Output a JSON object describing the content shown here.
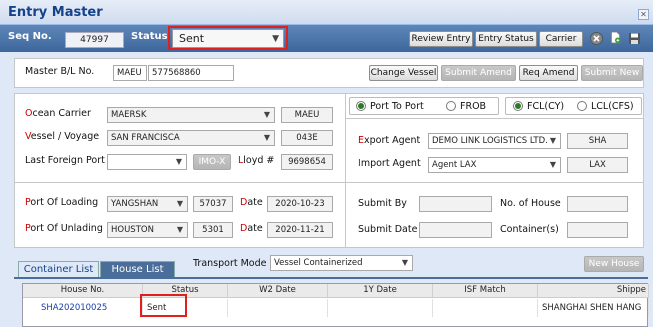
{
  "title": "Entry Master",
  "header": {
    "seq_label": "Seq No.",
    "seq_value": "47997",
    "status_label": "Status",
    "status_value": "Sent",
    "buttons": {
      "review": "Review Entry",
      "entry_status": "Entry Status",
      "carrier": "Carrier"
    }
  },
  "master": {
    "label": "Master B/L No.",
    "prefix": "MAEU",
    "number": "577568860"
  },
  "actions": {
    "change_vessel": "Change Vessel",
    "submit_amend": "Submit Amend",
    "req_amend": "Req Amend",
    "submit_new": "Submit New"
  },
  "carrier": {
    "ocean_label": "cean Carrier",
    "ocean_prefix": "O",
    "ocean_value": "MAERSK",
    "ocean_code": "MAEU",
    "vessel_label": "essel / Voyage",
    "vessel_prefix": "V",
    "vessel_value": "SAN FRANCISCA",
    "voyage": "043E",
    "lfp_label": "Last Foreign Port",
    "imo": "IMO-X",
    "lloyd_label": "loyd #",
    "lloyd_prefix": "L",
    "lloyd_value": "9698654"
  },
  "port_opts": {
    "p2p": "Port To Port",
    "frob": "FROB",
    "fcl": "FCL(CY)",
    "lcl": "LCL(CFS)"
  },
  "agents": {
    "export_label": "xport Agent",
    "export_prefix": "E",
    "export_value": "DEMO LINK LOGISTICS LTD.",
    "export_code": "SHA",
    "import_label": "mport Agent",
    "import_prefix": "I",
    "import_value": "Agent LAX",
    "import_code": "LAX"
  },
  "ports": {
    "pol_label": "ort Of Loading",
    "pol_prefix": "P",
    "pol_value": "YANGSHAN",
    "pol_code": "57037",
    "date_prefix": "D",
    "date_label": "ate",
    "pol_date": "2020-10-23",
    "pou_label": "ort Of Unlading",
    "pou_prefix": "P",
    "pou_value": "HOUSTON",
    "pou_code": "5301",
    "pou_date": "2020-11-21"
  },
  "submit": {
    "by": "Submit By",
    "date": "Submit Date",
    "houses": "No. of House",
    "containers": "Container(s)"
  },
  "tabs": {
    "container": "Container List",
    "house": "House List"
  },
  "transport": {
    "label": "Transport Mode",
    "value": "Vessel Containerized"
  },
  "new_house": "New House",
  "grid": {
    "headers": [
      "House No.",
      "Status",
      "W2 Date",
      "1Y Date",
      "ISF Match",
      "Shippe"
    ],
    "row": [
      "SHA202010025",
      "Sent",
      "",
      "",
      "",
      "SHANGHAI SHEN HANG"
    ]
  },
  "colors": {
    "accent": "#15428b",
    "highlight": "#e0201c"
  }
}
